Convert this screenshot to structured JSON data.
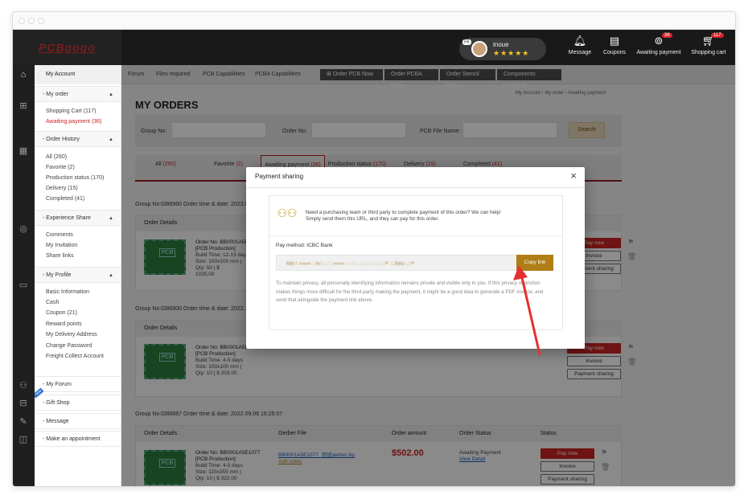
{
  "topbar": {
    "user_greeting": "Hi",
    "user_name": "inoue",
    "stars": "★★★★★",
    "items": [
      {
        "label": "Message",
        "icon": "bell-icon",
        "badge": ""
      },
      {
        "label": "Coupons",
        "icon": "coupon-icon",
        "badge": ""
      },
      {
        "label": "Awaiting payment",
        "icon": "wallet-icon",
        "badge": "36"
      },
      {
        "label": "Shopping cart",
        "icon": "cart-icon",
        "badge": "117"
      }
    ]
  },
  "sidebar": {
    "header": "My Account",
    "sections": [
      {
        "label": "- My order",
        "items": [
          "Shopping Cart (117)",
          "Awaiting payment (36)"
        ]
      },
      {
        "label": "- Order History",
        "items": [
          "All (260)",
          "Favorite (2)",
          "Production status (170)",
          "Delivery (15)",
          "Completed (41)"
        ]
      },
      {
        "label": "- Experience Share",
        "items": [
          "Comments",
          "My Invitation",
          "Share links"
        ]
      },
      {
        "label": "- My Profile",
        "items": [
          "Basic Information",
          "Cash",
          "Coupon (21)",
          "Reward points",
          "My Delivery Address",
          "Change Password",
          "Freight Collect Account"
        ]
      }
    ],
    "bottom": [
      "- My Forum",
      "- Gift Shop",
      "- Message",
      "- Make an appointment"
    ],
    "new_badge": "new"
  },
  "nav": {
    "items": [
      "Forum",
      "Files required",
      "PCB Capabilities",
      "PCBA Capabilities"
    ],
    "dark_items": [
      "Order PCB Now",
      "Order PCBA Now",
      "Order Stencil Now",
      "Components Sourcing"
    ]
  },
  "breadcrumb": "My Account  ›  My order  ›  Awaiting payment",
  "page_title": "MY ORDERS",
  "filters": {
    "group_no": "Group No:",
    "order_no": "Order No:",
    "pcb_file_name": "PCB File Name:",
    "search": "Search"
  },
  "tabs": [
    {
      "label": "All ",
      "count": "(260)"
    },
    {
      "label": "Favorite ",
      "count": "(2)"
    },
    {
      "label": "Awaiting payment ",
      "count": "(36)"
    },
    {
      "label": "Production status ",
      "count": "(170)"
    },
    {
      "label": "Delivery ",
      "count": "(15)"
    },
    {
      "label": "Completed ",
      "count": "(41)"
    }
  ],
  "groups": [
    {
      "title": "Group No:GB6960 Order time & date: 2023.01.",
      "order": {
        "no": "Order No: BB0001A5E",
        "type": "[PCB Production]",
        "build": "Build Time: 12-13 days",
        "size": "Size: 100x100 mm |",
        "qty": "Qty: 50 | $",
        "extra": "1025.00"
      }
    },
    {
      "title": "Group No:GB6900 Order time & date: 2022.10.",
      "order": {
        "no": "Order No: BB0001A5E",
        "type": "[PCB Production]",
        "build": "Build Time: 4-5 days",
        "size": "Size: 100x100 mm |",
        "qty": "Qty: 10 | $ 203.00",
        "extra": ""
      }
    },
    {
      "title": "Group No:GB6887 Order time & date: 2022.09.06 16:25:07",
      "order": {
        "no": "Order No: BB0001A5E1077",
        "type": "[PCB Production]",
        "build": "Build Time: 4-5 days",
        "size": "Size: 115x355 mm |",
        "qty": "Qty: 10 | $ 322.00",
        "extra": ""
      },
      "gerber": "BB0001A5E1077_测试gerber.zip",
      "add_notes": "Add notes",
      "amount": "$502.00",
      "status": "Awaiting Payment",
      "view_detail": "View Detail"
    }
  ],
  "card_headers": {
    "details": "Order Details",
    "gerber": "Gerber File",
    "amount": "Order amount",
    "status": "Order Status",
    "status2": "Status"
  },
  "actions": {
    "pay_now": "Pay now",
    "invoice": "Invoice",
    "payment_sharing": "Payment sharing"
  },
  "modal": {
    "title": "Payment sharing",
    "close": "×",
    "info_line1": "Need a purchasing team or third party to complete payment of this order? We can help!",
    "info_line2": "Simply send them this URL, and they can pay for this order.",
    "pay_method": "Pay method: ICBC Bank",
    "link_value": "Mb:!  ═══  ∴h⁄∴∴∴  ═══  ∴ ∴; ∴∴∴∴ ∴∴∴ᴹ ∴JMb∴∴ᴹ",
    "copy_link": "Copy link",
    "privacy": "To maintain privacy, all personally identifying information remains private and visible only to you. If this privacy restriction makes things more difficult for the third-party making the payment, it might be a good idea to generate a PDF invoice, and send that alongside the payment link above."
  },
  "colors": {
    "accent": "#b07d16",
    "brand_red": "#cc2323",
    "arrow": "#e53030"
  }
}
